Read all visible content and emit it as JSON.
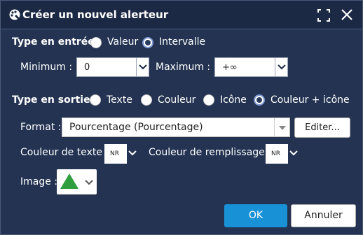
{
  "dialog": {
    "title": "Créer un nouvel alerteur",
    "icons": {
      "title_icon": "palette-icon",
      "maximize": "maximize-icon",
      "close": "close-icon"
    }
  },
  "input_type": {
    "label": "Type en entrée :",
    "options": [
      "Valeur",
      "Intervalle"
    ],
    "selected": "Intervalle"
  },
  "range": {
    "min_label": "Minimum :",
    "min_value": "0",
    "max_label": "Maximum :",
    "max_value": "+∞"
  },
  "output_type": {
    "label": "Type en sortie :",
    "options": [
      "Texte",
      "Couleur",
      "Icône",
      "Couleur + icône"
    ],
    "selected": "Couleur + icône"
  },
  "format": {
    "label": "Format :",
    "value": "Pourcentage (Pourcentage)",
    "edit_button": "Editer..."
  },
  "colors": {
    "text_label": "Couleur de texte :",
    "text_value": "NR",
    "fill_label": "Couleur de remplissage :",
    "fill_value": "NR"
  },
  "image": {
    "label": "Image :",
    "icon": "triangle-up-icon",
    "icon_color": "#2e9e3e"
  },
  "buttons": {
    "ok": "OK",
    "cancel": "Annuler"
  },
  "colors_theme": {
    "background": "#243352",
    "primary_button": "#1991d6"
  }
}
